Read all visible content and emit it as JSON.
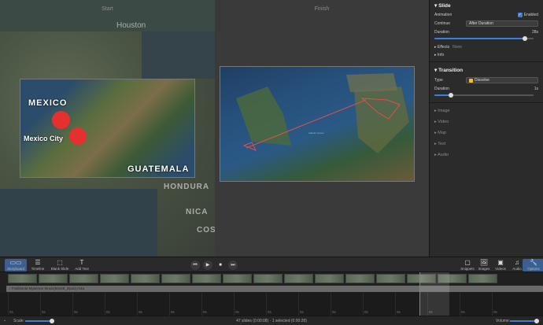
{
  "canvas": {
    "start_label": "Start",
    "finish_label": "Finish",
    "start_bg_labels": [
      "Houston",
      "HONDURA",
      "NICA",
      "COS"
    ],
    "start_map_labels": {
      "country": "MEXICO",
      "city": "Mexico City",
      "region": "GUATEMALA"
    },
    "finish_map_caption": "Atlantic Ocean"
  },
  "inspector": {
    "slide": {
      "title": "Slide",
      "animation_label": "Animation",
      "enabled_label": "Enabled",
      "enabled": true,
      "continue_label": "Continue",
      "continue_value": "After Duration",
      "duration_label": "Duration",
      "duration_value": "28s",
      "duration_fraction": 0.9,
      "effects_label": "Effects",
      "effects_value": "None",
      "info_label": "Info"
    },
    "transition": {
      "title": "Transition",
      "type_label": "Type",
      "type_value": "Dissolve",
      "duration_label": "Duration",
      "duration_value": "1s",
      "duration_fraction": 0.15
    },
    "collapsed_sections": [
      "Image",
      "Video",
      "Map",
      "Text",
      "Audio"
    ]
  },
  "toolbar": {
    "left_buttons": [
      {
        "label": "Storyboard",
        "icon": "storyboard-icon",
        "active": true
      },
      {
        "label": "Timeline",
        "icon": "timeline-icon",
        "active": false
      },
      {
        "label": "Blank Slide",
        "icon": "blank-slide-icon",
        "active": false
      },
      {
        "label": "Add Text",
        "icon": "text-icon",
        "active": false
      }
    ],
    "right_buttons": [
      {
        "label": "Snippets",
        "icon": "snippets-icon",
        "active": false
      },
      {
        "label": "Images",
        "icon": "images-icon",
        "active": false
      },
      {
        "label": "Videos",
        "icon": "videos-icon",
        "active": false
      },
      {
        "label": "Audio",
        "icon": "audio-icon",
        "active": false
      },
      {
        "label": "Options",
        "icon": "wrench-icon",
        "active": true
      }
    ]
  },
  "timeline": {
    "audio_file": "Traditional Myanmar Music(53448_Opus).m4a",
    "ruler_labels": [
      "0s",
      "0s",
      "0s",
      "0s",
      "0s",
      "0s",
      "0s",
      "0s",
      "0s",
      "0s",
      "0s",
      "0s",
      "0s",
      "0s",
      "0s",
      "0s"
    ]
  },
  "statusbar": {
    "scale_label": "Scale:",
    "info": "47 slides (0:00:08) · 1 selected (0:00:28)",
    "volume_label": "Volume:"
  },
  "colors": {
    "accent": "#3b7fd8",
    "pin": "#e53030",
    "route": "#e0504a"
  }
}
